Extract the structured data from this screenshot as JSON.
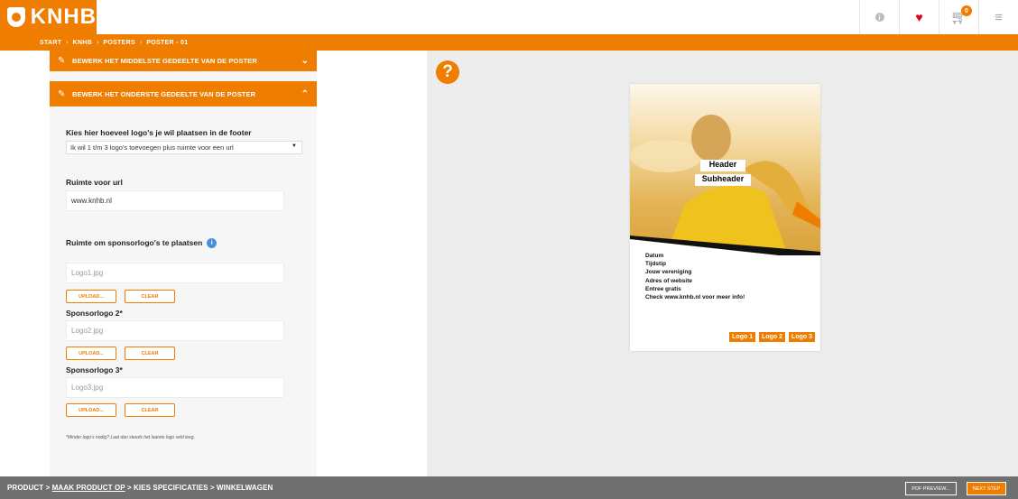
{
  "header": {
    "logo_text": "KNHB",
    "brand_color": "#ef7d00",
    "icons": [
      "info-icon",
      "heart-icon",
      "cart-icon",
      "menu-icon"
    ],
    "cart_count": "0"
  },
  "breadcrumb": [
    "START",
    "KNHB",
    "POSTERS",
    "POSTER - 01"
  ],
  "panel": {
    "section_middle_label": "BEWERK HET MIDDELSTE GEDEELTE VAN DE POSTER",
    "section_bottom_label": "BEWERK HET ONDERSTE GEDEELTE VAN DE POSTER",
    "footer_logos_label": "Kies hier hoeveel logo's je wil plaatsen in de footer",
    "footer_logos_value": "Ik wil 1 t/m 3 logo's toevoegen plus ruimte voor een url",
    "url_label": "Ruimte voor url",
    "url_value": "www.knhb.nl",
    "sponsor_label": "Ruimte om sponsorlogo's te plaatsen",
    "sponsor_slots": [
      {
        "label": "",
        "placeholder": "Logo1.jpg"
      },
      {
        "label": "Sponsorlogo 2*",
        "placeholder": "Logo2.jpg"
      },
      {
        "label": "Sponsorlogo 3*",
        "placeholder": "Logo3.jpg"
      }
    ],
    "upload_label": "UPLOAD...",
    "clear_label": "CLEAR",
    "footnote": "*Minder logo's nodig? Laat dan steeds het laatste logo veld leeg."
  },
  "preview": {
    "help_symbol": "?",
    "header_text": "Header",
    "subheader_text": "Subheader",
    "info_lines": [
      "Datum",
      "Tijdstip",
      "Jouw vereniging",
      "Adres of website",
      "Entree gratis",
      "Check www.knhb.nl voor meer info!"
    ],
    "logos": [
      "Logo 1",
      "Logo 2",
      "Logo 3"
    ]
  },
  "footer": {
    "steps_before": "PRODUCT > ",
    "steps_current": "MAAK PRODUCT OP",
    "steps_after": " > KIES SPECIFICATIES > WINKELWAGEN",
    "pdf_preview_label": "PDF PREVIEW...",
    "next_step_label": "NEXT STEP"
  }
}
